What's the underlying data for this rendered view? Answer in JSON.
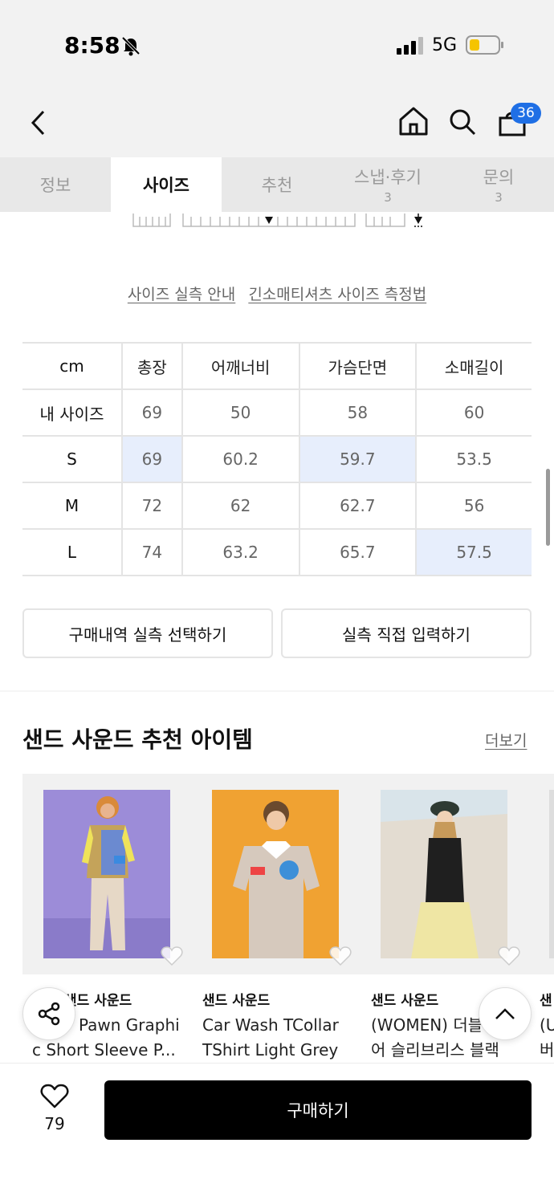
{
  "status": {
    "time": "8:58",
    "network": "5G"
  },
  "nav": {
    "cart_count": "36"
  },
  "tabs": [
    {
      "label": "정보",
      "count": ""
    },
    {
      "label": "사이즈",
      "count": ""
    },
    {
      "label": "추천",
      "count": ""
    },
    {
      "label": "스냅·후기",
      "count": "3"
    },
    {
      "label": "문의",
      "count": "3"
    }
  ],
  "size_links": {
    "guide": "사이즈 실측 안내",
    "method": "긴소매티셔츠 사이즈 측정법"
  },
  "size_table": {
    "unit": "cm",
    "columns": [
      "총장",
      "어깨너비",
      "가슴단면",
      "소매길이"
    ],
    "rows": [
      {
        "label": "내 사이즈",
        "values": [
          "69",
          "50",
          "58",
          "60"
        ]
      },
      {
        "label": "S",
        "values": [
          "69",
          "60.2",
          "59.7",
          "53.5"
        ]
      },
      {
        "label": "M",
        "values": [
          "72",
          "62",
          "62.7",
          "56"
        ]
      },
      {
        "label": "L",
        "values": [
          "74",
          "63.2",
          "65.7",
          "57.5"
        ]
      }
    ]
  },
  "actions": {
    "purchase_history": "구매내역 실측 선택하기",
    "direct_input": "실측 직접 입력하기"
  },
  "recommend": {
    "title": "샌드 사운드 추천 아이템",
    "more": "더보기",
    "items": [
      {
        "brand": "샌드 사운드",
        "line1": "Pawn Graphi",
        "line2": "c Short Sleeve P..."
      },
      {
        "brand": "샌드 사운드",
        "line1": "Car Wash TCollar",
        "line2": "TShirt Light Grey"
      },
      {
        "brand": "샌드 사운드",
        "line1": "(WOMEN) 더블",
        "line2": "어 슬리브리스 블랙"
      },
      {
        "brand": "샌",
        "line1": "(U",
        "line2": "버"
      }
    ]
  },
  "bottom": {
    "like_count": "79",
    "buy_label": "구매하기"
  },
  "colors": {
    "accent": "#1f6fe5",
    "highlight": "#e7eefc",
    "buy_bg": "#000000"
  }
}
